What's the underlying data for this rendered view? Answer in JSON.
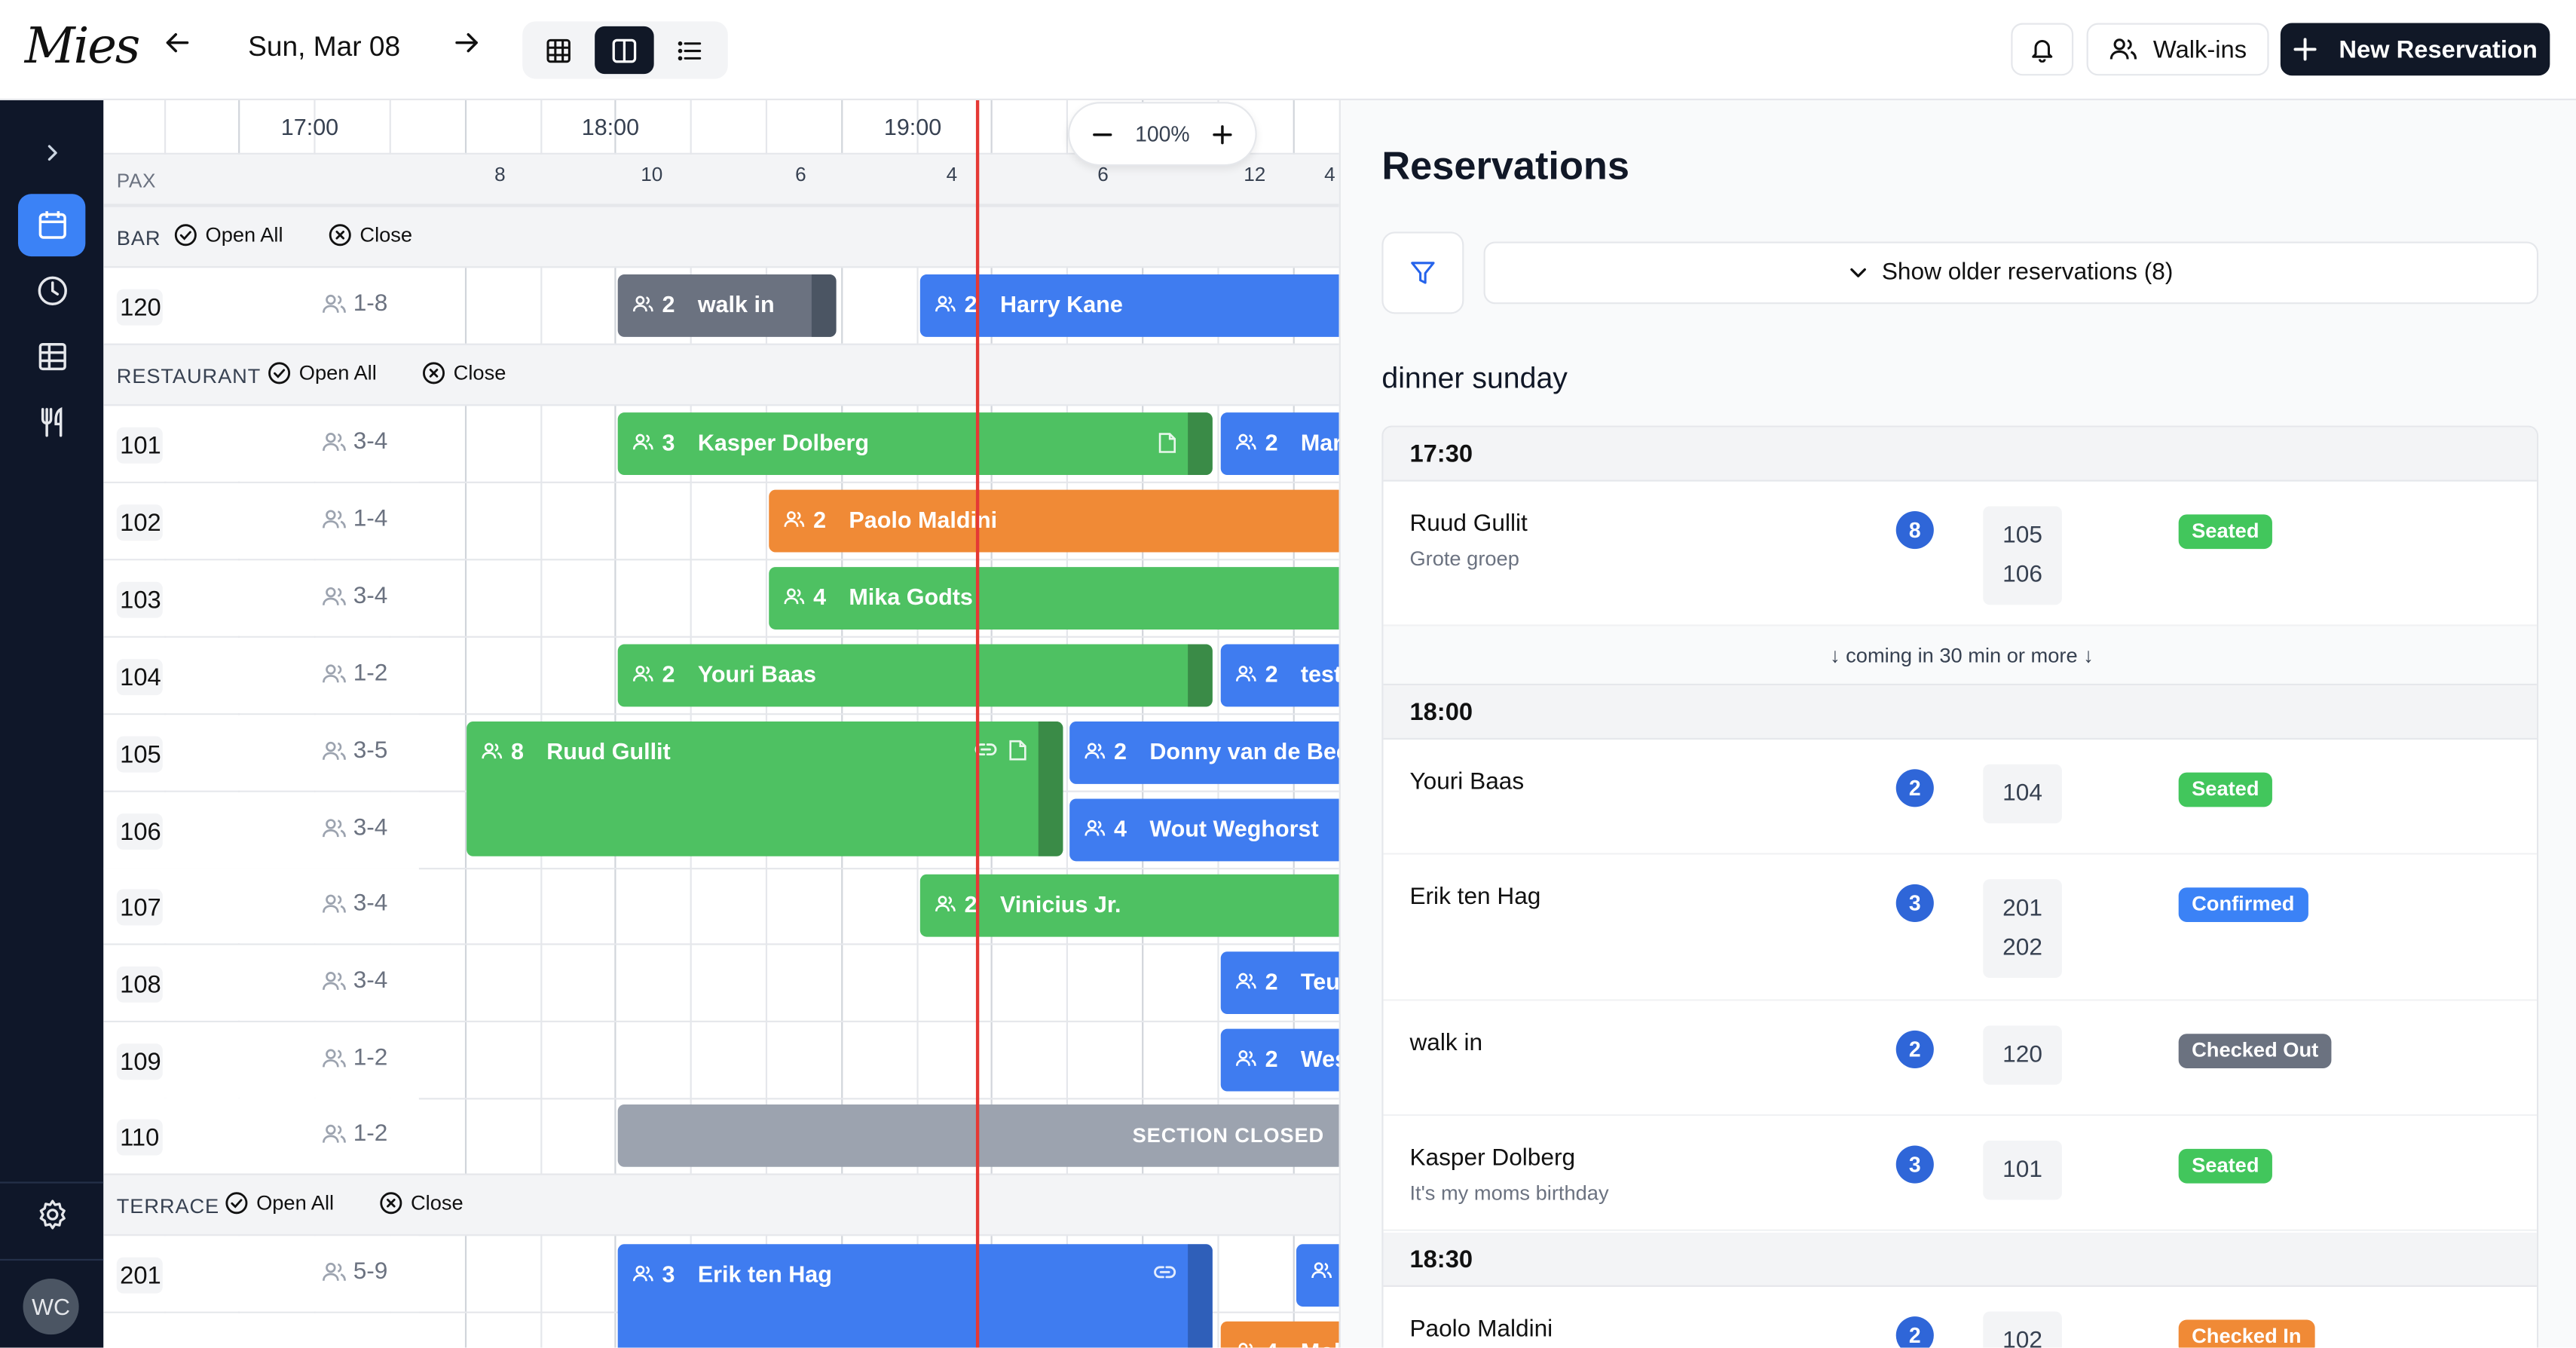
{
  "header": {
    "logo": "Mies",
    "date": "Sun, Mar 08",
    "walkins_label": "Walk-ins",
    "new_reservation_label": "New Reservation"
  },
  "sidebar": {
    "user_initials": "WC"
  },
  "timeline": {
    "hours": [
      "17:00",
      "18:00",
      "19:00"
    ],
    "pax_label": "PAX",
    "pax_values": [
      "8",
      "10",
      "6",
      "4",
      "6",
      "12",
      "4"
    ],
    "zoom": "100%",
    "open_all_label": "Open All",
    "close_label": "Close",
    "closed_label": "SECTION CLOSED",
    "sections": [
      {
        "name": "BAR",
        "tables": [
          {
            "num": "120",
            "cap": "1-8"
          }
        ]
      },
      {
        "name": "RESTAURANT",
        "tables": [
          {
            "num": "101",
            "cap": "3-4"
          },
          {
            "num": "102",
            "cap": "1-4"
          },
          {
            "num": "103",
            "cap": "3-4"
          },
          {
            "num": "104",
            "cap": "1-2"
          },
          {
            "num": "105",
            "cap": "3-5"
          },
          {
            "num": "106",
            "cap": "3-4"
          },
          {
            "num": "107",
            "cap": "3-4"
          },
          {
            "num": "108",
            "cap": "3-4"
          },
          {
            "num": "109",
            "cap": "1-2"
          },
          {
            "num": "110",
            "cap": "1-2"
          }
        ]
      },
      {
        "name": "TERRACE",
        "tables": [
          {
            "num": "201",
            "cap": "5-9"
          }
        ]
      }
    ],
    "bookings": [
      {
        "pax": "2",
        "name": "walk in"
      },
      {
        "pax": "2",
        "name": "Harry Kane"
      },
      {
        "pax": "3",
        "name": "Kasper Dolberg"
      },
      {
        "pax": "2",
        "name": "Marc"
      },
      {
        "pax": "2",
        "name": "Paolo Maldini"
      },
      {
        "pax": "4",
        "name": "Mika Godts"
      },
      {
        "pax": "2",
        "name": "Youri Baas"
      },
      {
        "pax": "2",
        "name": "test"
      },
      {
        "pax": "8",
        "name": "Ruud Gullit"
      },
      {
        "pax": "2",
        "name": "Donny van de Beek"
      },
      {
        "pax": "4",
        "name": "Wout Weghorst"
      },
      {
        "pax": "2",
        "name": "Vinicius Jr."
      },
      {
        "pax": "2",
        "name": "Teun"
      },
      {
        "pax": "2",
        "name": "Wes"
      },
      {
        "pax": "3",
        "name": "Erik ten Hag"
      },
      {
        "pax": "4",
        "name": "Moh"
      }
    ]
  },
  "panel": {
    "title": "Reservations",
    "older_label": "Show older reservations (8)",
    "group_title": "dinner sunday",
    "coming_note": "↓ coming in 30 min or more ↓",
    "slots": [
      "17:30",
      "18:00",
      "18:30"
    ],
    "items": [
      {
        "name": "Ruud Gullit",
        "note": "Grote groep",
        "pax": "8",
        "tables": "105\n106",
        "status": "Seated"
      },
      {
        "name": "Youri Baas",
        "note": "",
        "pax": "2",
        "tables": "104",
        "status": "Seated"
      },
      {
        "name": "Erik ten Hag",
        "note": "",
        "pax": "3",
        "tables": "201\n202",
        "status": "Confirmed"
      },
      {
        "name": "walk in",
        "note": "",
        "pax": "2",
        "tables": "120",
        "status": "Checked Out"
      },
      {
        "name": "Kasper Dolberg",
        "note": "It's my moms birthday",
        "pax": "3",
        "tables": "101",
        "status": "Seated"
      },
      {
        "name": "Paolo Maldini",
        "note": "",
        "pax": "2",
        "tables": "102",
        "status": "Checked In"
      }
    ]
  },
  "colors": {
    "seated": "#42c65c",
    "confirmed": "#3b82f6",
    "checked_out": "#6b7280",
    "checked_in": "#f08a36",
    "now_line": "#e53935",
    "sidebar_bg": "#0f1729"
  },
  "icons": [
    "arrow-left-icon",
    "arrow-right-icon",
    "grid-view-icon",
    "split-view-icon",
    "list-view-icon",
    "bell-icon",
    "users-icon",
    "plus-icon",
    "chevron-right-icon",
    "calendar-icon",
    "clock-icon",
    "table-icon",
    "utensils-icon",
    "settings-icon",
    "filter-icon",
    "chevron-down-icon",
    "check-circle-icon",
    "x-circle-icon",
    "note-icon",
    "link-icon"
  ]
}
